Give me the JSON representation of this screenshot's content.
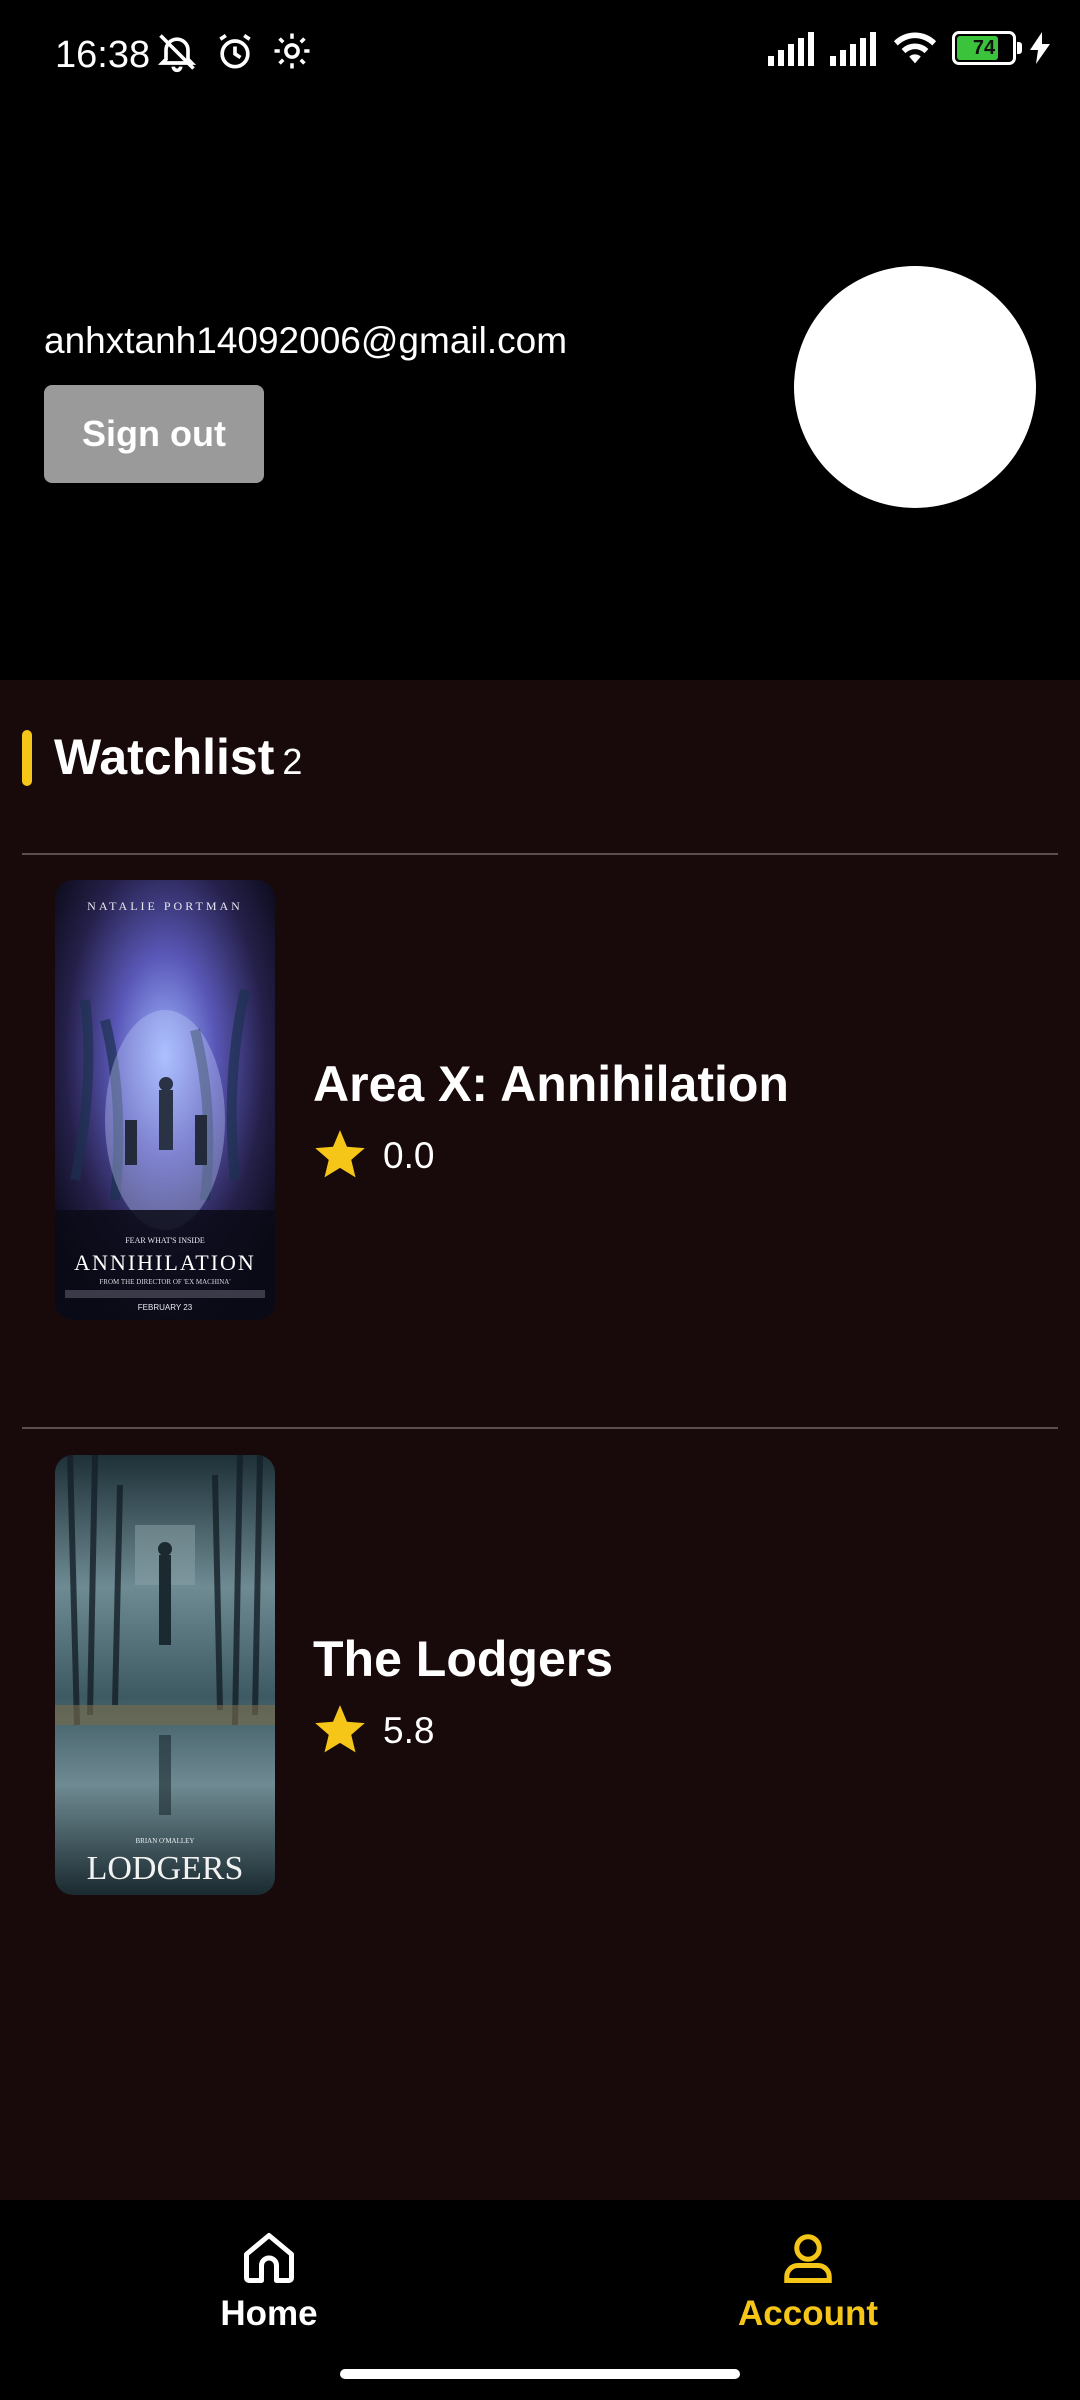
{
  "status_bar": {
    "time": "16:38",
    "battery": "74"
  },
  "account": {
    "email": "anhxtanh14092006@gmail.com",
    "sign_out_label": "Sign out"
  },
  "watchlist": {
    "title": "Watchlist",
    "count": "2",
    "items": [
      {
        "title": "Area X: Annihilation",
        "rating": "0.0",
        "poster": {
          "top_text": "NATALIE PORTMAN",
          "tagline": "FEAR WHAT'S INSIDE",
          "name": "ANNIHILATION",
          "credit": "FROM THE DIRECTOR OF 'EX MACHINA'",
          "date": "FEBRUARY 23"
        }
      },
      {
        "title": "The Lodgers",
        "rating": "5.8",
        "poster": {
          "director": "BRIAN O'MALLEY",
          "name": "LODGERS"
        }
      }
    ]
  },
  "nav": {
    "home_label": "Home",
    "account_label": "Account",
    "active": "account",
    "active_color": "#f5c518"
  },
  "colors": {
    "accent": "#f5c518",
    "content_bg": "#180a0a",
    "button_bg": "#9a9a9a"
  }
}
